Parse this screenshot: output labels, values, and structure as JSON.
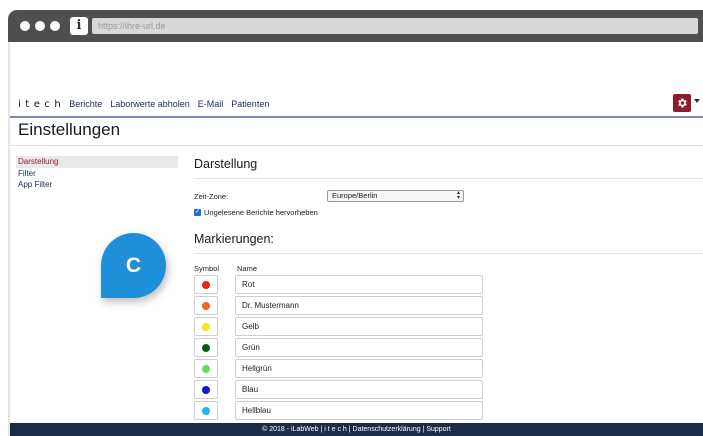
{
  "browser": {
    "url": "https://ihre-url.de",
    "info_icon": "i"
  },
  "nav": {
    "logo": "itech",
    "links": [
      "Berichte",
      "Laborwerte abholen",
      "E-Mail",
      "Patienten"
    ]
  },
  "page_title": "Einstellungen",
  "sidebar": {
    "items": [
      "Darstellung",
      "Filter",
      "App Filter"
    ],
    "active": "Darstellung"
  },
  "badge": {
    "letter": "C"
  },
  "darstellung": {
    "title": "Darstellung",
    "timezone_label": "Zeit-Zone:",
    "timezone_value": "Europe/Berlin",
    "highlight_label": "Ungelesene Berichte hervorheben",
    "highlight_checked": true
  },
  "markierungen": {
    "title": "Markierungen:",
    "col_symbol": "Symbol",
    "col_name": "Name",
    "rows": [
      {
        "name": "Rot",
        "color": "#e8261c"
      },
      {
        "name": "Dr. Mustermann",
        "color": "#f0651c"
      },
      {
        "name": "Gelb",
        "color": "#f2ea1e"
      },
      {
        "name": "Grün",
        "color": "#0d5a12"
      },
      {
        "name": "Hellgrün",
        "color": "#5de05a"
      },
      {
        "name": "Blau",
        "color": "#1418c8"
      },
      {
        "name": "Hellblau",
        "color": "#1fb6e8"
      }
    ]
  },
  "footer": {
    "text": "© 2018 - iLabWeb | i t e c h | Datenschutzerklärung | Support"
  },
  "colors": {
    "accent": "#8b1e2a",
    "nav_blue": "#1b2b55",
    "footer_bg": "#1c2b4a",
    "badge": "#1f8fd9"
  }
}
